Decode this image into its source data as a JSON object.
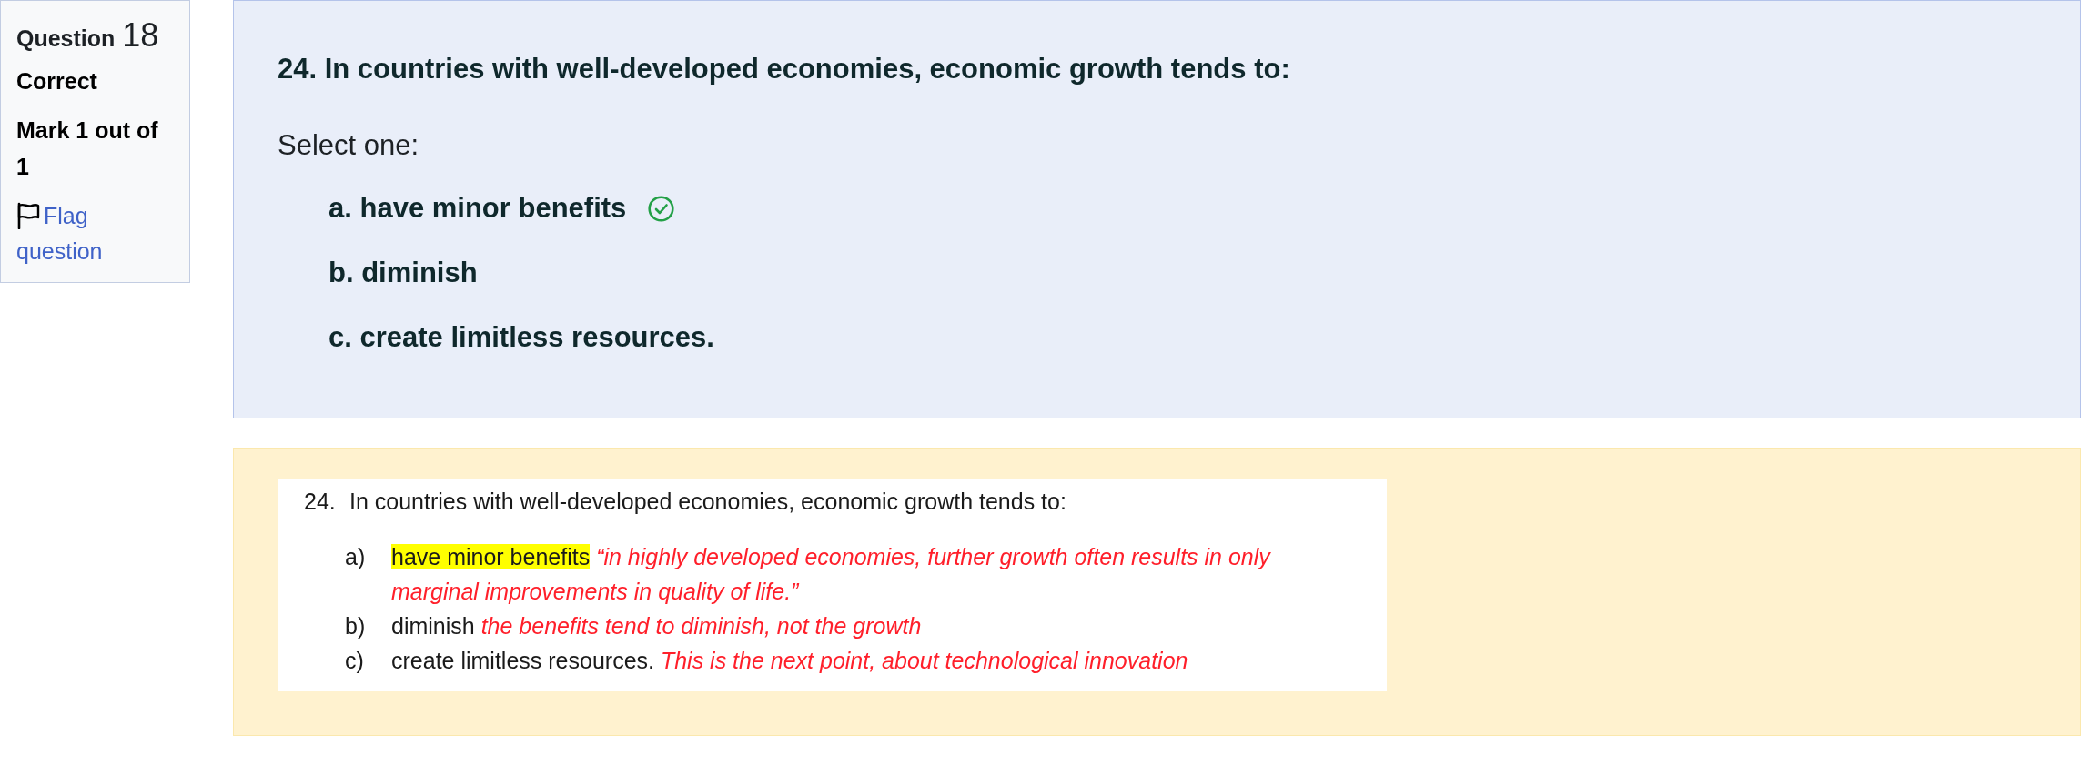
{
  "question_info": {
    "label": "Question",
    "number": "18",
    "state": "Correct",
    "grade": "Mark 1 out of 1",
    "flag": {
      "label": "Flag question",
      "flagged": false
    }
  },
  "question": {
    "text": "24. In countries with well-developed economies, economic growth tends to:",
    "prompt": "Select one:",
    "options": [
      {
        "text": "a. have minor benefits",
        "correct": true
      },
      {
        "text": "b. diminish",
        "correct": false
      },
      {
        "text": "c. create limitless resources.",
        "correct": false
      }
    ]
  },
  "feedback": {
    "number": "24.",
    "text": "In countries with well-developed economies, economic growth tends to:",
    "items": [
      {
        "label": "a)",
        "answer": "have minor benefits",
        "highlighted": true,
        "comment": "“in highly developed economies, further growth often results in only marginal improvements in quality of life.”"
      },
      {
        "label": "b)",
        "answer": "diminish",
        "highlighted": false,
        "comment": "the benefits tend to diminish, not the growth"
      },
      {
        "label": "c)",
        "answer": "create limitless resources.",
        "highlighted": false,
        "comment": "This is the next point, about technological innovation"
      }
    ]
  }
}
